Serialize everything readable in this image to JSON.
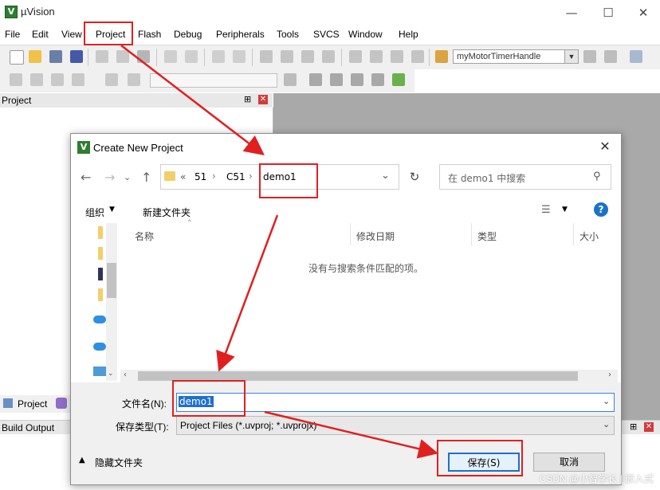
{
  "window": {
    "title": "µVision",
    "icon_letter": "V"
  },
  "menu": [
    "File",
    "Edit",
    "View",
    "Project",
    "Flash",
    "Debug",
    "Peripherals",
    "Tools",
    "SVCS",
    "Window",
    "Help"
  ],
  "toolbar": {
    "target_name": "myMotorTimerHandle"
  },
  "panels": {
    "project_head": "Project",
    "project_tab": "Project",
    "build_output": "Build Output"
  },
  "dialog": {
    "title": "Create New Project",
    "breadcrumb": [
      "«",
      "51",
      "C51",
      "demo1"
    ],
    "search_placeholder": "在 demo1 中搜索",
    "organize": "组织",
    "new_folder": "新建文件夹",
    "columns": [
      "名称",
      "修改日期",
      "类型",
      "大小"
    ],
    "empty_message": "没有与搜索条件匹配的项。",
    "filename_label": "文件名(N):",
    "filename_value": "demo1",
    "filetype_label": "保存类型(T):",
    "filetype_value": "Project Files (*.uvproj; *.uvprojx)",
    "hide_folders": "隐藏文件夹",
    "save_button": "保存(S)",
    "cancel_button": "取消"
  },
  "watermark": "CSDN @小智学长 | 嵌入式",
  "colors": {
    "annotation_red": "#e02020",
    "accent_blue": "#3c7fd8",
    "app_green": "#2e7d32"
  }
}
